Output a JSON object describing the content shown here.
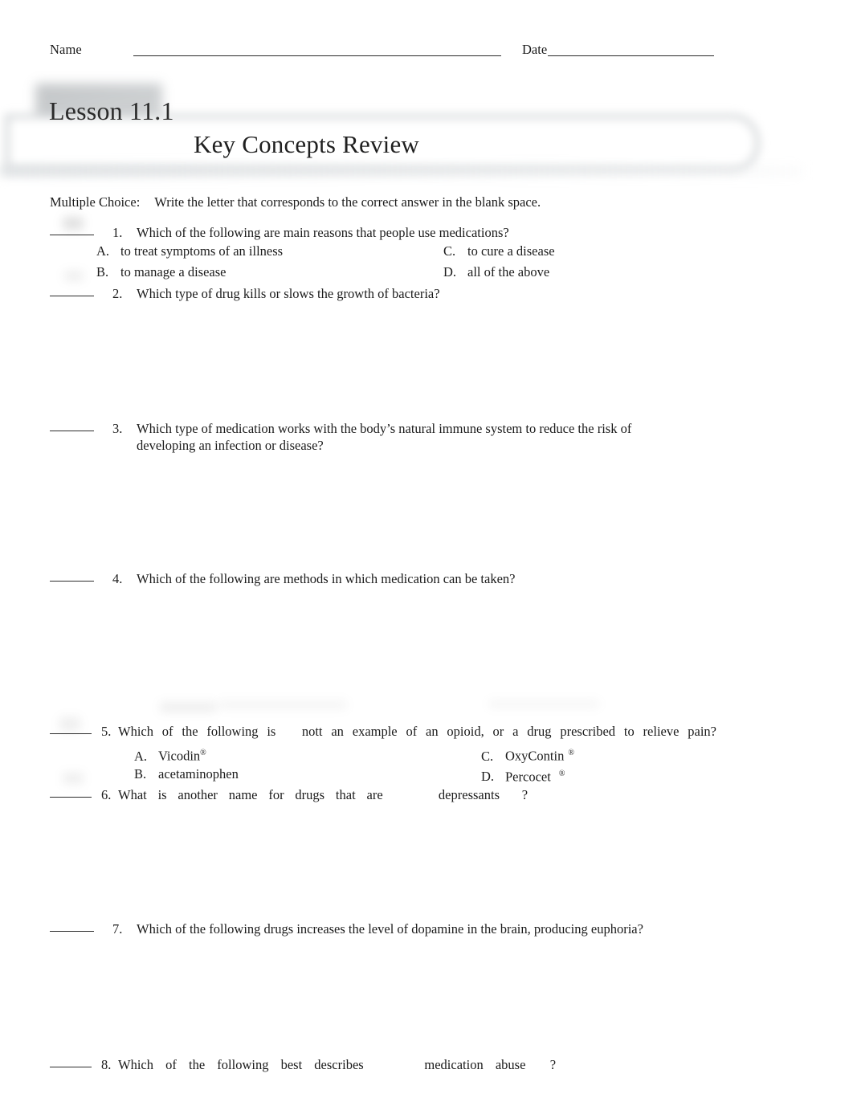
{
  "document": {
    "header": {
      "name_label": "Name",
      "date_label": "Date"
    },
    "banner": {
      "lesson": "Lesson 11.1",
      "subtitle": "Key Concepts Review"
    },
    "instructions": {
      "label": "Multiple Choice:",
      "text": "Write the letter that corresponds to the correct answer in the blank space."
    },
    "questions": [
      {
        "number": "1.",
        "text": "Which of the following are main reasons that people use medications?",
        "options": [
          {
            "letter": "A.",
            "text": "to treat symptoms of an illness"
          },
          {
            "letter": "C.",
            "text": "to cure a disease"
          },
          {
            "letter": "B.",
            "text": "to manage a disease"
          },
          {
            "letter": "D.",
            "text": "all of the above"
          }
        ]
      },
      {
        "number": "2.",
        "text": "Which type of drug kills or slows the growth of bacteria?",
        "options": []
      },
      {
        "number": "3.",
        "text": "Which type of medication works with the body’s natural immune system to reduce the risk of developing an infection or disease?",
        "options": []
      },
      {
        "number": "4.",
        "text": "Which of the following are methods in which medication can be taken?",
        "options": []
      },
      {
        "number": "5.",
        "text_before": "Which of the following is",
        "text_emphasis": "nott",
        "text_after": "an example of an opioid, or a drug prescribed to relieve pain?",
        "options": [
          {
            "letter": "A.",
            "text": "Vicodin",
            "mark": "®"
          },
          {
            "letter": "C.",
            "text": "OxyContin",
            "mark": "®"
          },
          {
            "letter": "B.",
            "text": "acetaminophen",
            "mark": ""
          },
          {
            "letter": "D.",
            "text": "Percocet",
            "mark": "®"
          }
        ]
      },
      {
        "number": "6.",
        "text_before": "What is another name for drugs that are",
        "text_emphasis": "depressants",
        "text_after": "?",
        "options": []
      },
      {
        "number": "7.",
        "text": "Which of the following drugs increases the level of dopamine in the brain, producing euphoria?",
        "options": []
      },
      {
        "number": "8.",
        "text_before": "Which of the following best describes",
        "text_emphasis": "medication abuse",
        "text_after": "?",
        "options": []
      }
    ]
  }
}
